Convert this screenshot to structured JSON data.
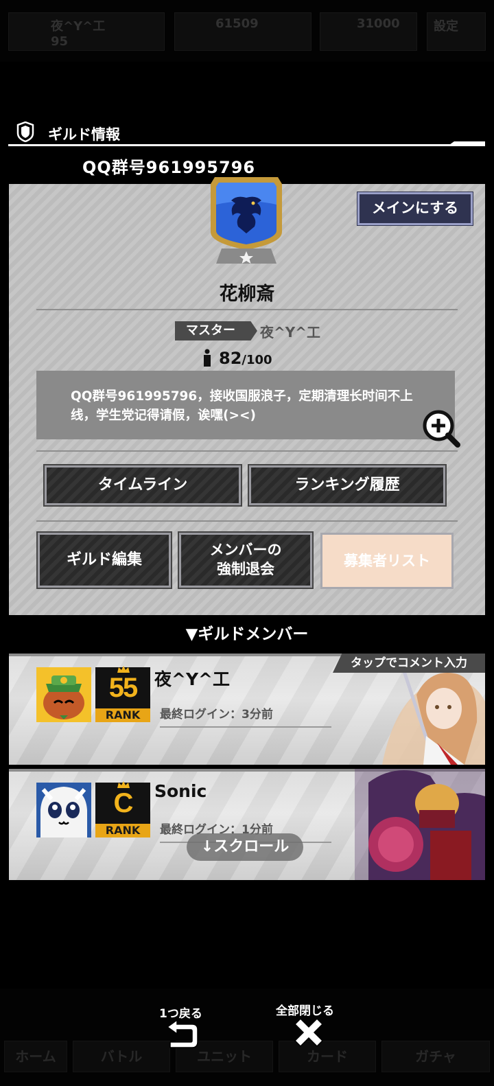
{
  "header": {
    "title": "ギルド情報"
  },
  "qq_title": "QQ群号961995796",
  "guild": {
    "set_main_label": "メインにする",
    "name": "花柳斎",
    "master_tag": "マスター",
    "master_name": "夜^Y^工",
    "member_count": "82",
    "member_max": "/100",
    "description": "QQ群号961995796，接收国服浪子，定期清理长时间不上线，学生党记得请假，诶嘿(><)"
  },
  "buttons": {
    "timeline": "タイムライン",
    "ranking_history": "ランキング履歴",
    "guild_edit": "ギルド編集",
    "kick_line1": "メンバーの",
    "kick_line2": "強制退会",
    "recruit_list": "募集者リスト"
  },
  "members_title": "▼ギルドメンバー",
  "members": [
    {
      "name": "夜^Y^工",
      "rank_value": "55",
      "rank_label": "RANK",
      "last_login": "最終ログイン：3分前",
      "comment_hint": "タップでコメント入力"
    },
    {
      "name": "Sonic",
      "rank_value": "C",
      "rank_label": "RANK",
      "last_login": "最終ログイン：1分前"
    }
  ],
  "scroll_hint": "↓スクロール",
  "footer": {
    "back_label": "1つ戻る",
    "close_label": "全部閉じる"
  },
  "colors": {
    "accent_navy": "#2f3350",
    "rank_gold": "#e8a516",
    "recruit_disabled": "#f6dcc8"
  },
  "background": {
    "top_labels": [
      "夜^Y^工",
      "95",
      "61509",
      "31000",
      "設定"
    ],
    "nav_labels": [
      "ホーム",
      "バトル",
      "ユニット",
      "カード",
      "ガチャ"
    ]
  }
}
